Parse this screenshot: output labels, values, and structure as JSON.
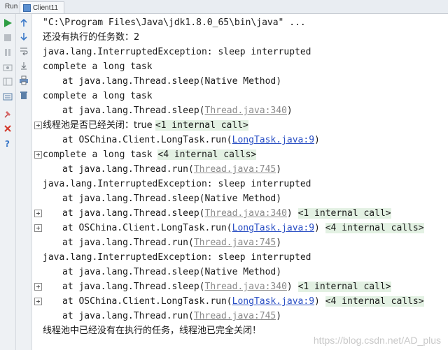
{
  "tabbar": {
    "run_label": "Run",
    "tab_label": "Client11"
  },
  "console_lines": [
    {
      "cmd": "\"C:\\Program Files\\Java\\jdk1.8.0_65\\bin\\java\" ..."
    },
    {
      "text": "还没有执行的任务数：2"
    },
    {
      "text": "java.lang.InterruptedException: sleep interrupted"
    },
    {
      "text": "complete a long task"
    },
    {
      "text": "at java.lang.Thread.sleep(Native Method)"
    },
    {
      "text": "complete a long task"
    },
    {
      "text": "at java.lang.Thread.sleep(",
      "link": "Thread.java:340",
      "tail": ")"
    },
    {
      "text": "线程池是否已经关闭：true ",
      "fold": "<1 internal call>"
    },
    {
      "text": "at OSChina.Client.LongTask.run(",
      "link": "LongTask.java:9",
      "tail": ")"
    },
    {
      "text": "complete a long task ",
      "fold": "<4 internal calls>"
    },
    {
      "text": "at java.lang.Thread.run(",
      "link": "Thread.java:745",
      "tail": ")"
    },
    {
      "text": "java.lang.InterruptedException: sleep interrupted"
    },
    {
      "text": "at java.lang.Thread.sleep(Native Method)"
    },
    {
      "text": "at java.lang.Thread.sleep(",
      "link": "Thread.java:340",
      "tail": ")",
      "fold": "<1 internal call>"
    },
    {
      "text": "at OSChina.Client.LongTask.run(",
      "link": "LongTask.java:9",
      "tail": ")",
      "fold": "<4 internal calls>"
    },
    {
      "text": "at java.lang.Thread.run(",
      "link": "Thread.java:745",
      "tail": ")"
    },
    {
      "text": "java.lang.InterruptedException: sleep interrupted"
    },
    {
      "text": "at java.lang.Thread.sleep(Native Method)"
    },
    {
      "text": "at java.lang.Thread.sleep(",
      "link": "Thread.java:340",
      "tail": ")",
      "fold": "<1 internal call>"
    },
    {
      "text": "at OSChina.Client.LongTask.run(",
      "link": "LongTask.java:9",
      "tail": ")",
      "fold": "<4 internal calls>"
    },
    {
      "text": "at java.lang.Thread.run(",
      "link": "Thread.java:745",
      "tail": ")"
    },
    {
      "text": "线程池中已经没有在执行的任务，线程池已完全关闭！"
    }
  ],
  "watermark": "https://blog.csdn.net/AD_plus",
  "colors": {
    "link": "#2a4fc4",
    "fold_bg": "#e3f1e3",
    "run_green": "#2f9e44",
    "stop_red": "#d33a2c"
  }
}
